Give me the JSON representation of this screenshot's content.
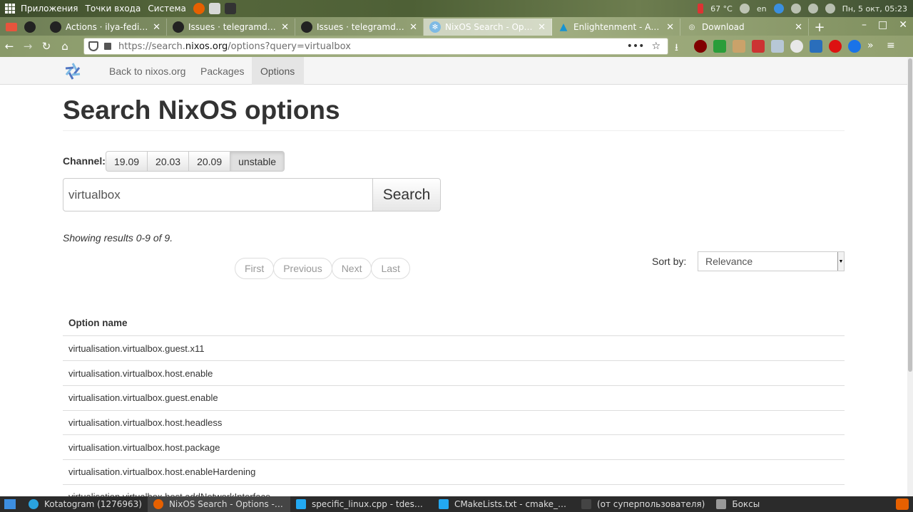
{
  "desktop": {
    "menus": [
      "Приложения",
      "Точки входа",
      "Система"
    ],
    "temperature": "67 °C",
    "keyboard_layout": "en",
    "datetime": "Пн, 5 окт, 05:23"
  },
  "browser": {
    "tabs": [
      {
        "title": "Actions · ilya-fedin/td",
        "icon": "github-icon"
      },
      {
        "title": "Issues · telegramdesk",
        "icon": "github-icon"
      },
      {
        "title": "Issues · telegramdesk",
        "icon": "github-icon"
      },
      {
        "title": "NixOS Search - Option",
        "icon": "nixos-icon",
        "active": true
      },
      {
        "title": "Enlightenment - Arch",
        "icon": "arch-icon"
      },
      {
        "title": "Download",
        "icon": "download-icon"
      }
    ],
    "url_prefix": "https://search.",
    "url_domain": "nixos.org",
    "url_suffix": "/options?query=virtualbox"
  },
  "site": {
    "nav": [
      "Back to nixos.org",
      "Packages",
      "Options"
    ],
    "active_nav": "Options",
    "page_title": "Search NixOS options",
    "channel_label": "Channel:",
    "channels": [
      "19.09",
      "20.03",
      "20.09",
      "unstable"
    ],
    "active_channel": "unstable",
    "search_value": "virtualbox",
    "search_button": "Search",
    "results_count": "Showing results 0-9 of 9.",
    "pager": [
      "First",
      "Previous",
      "Next",
      "Last"
    ],
    "sort_label": "Sort by:",
    "sort_value": "Relevance",
    "table_header": "Option name",
    "options": [
      "virtualisation.virtualbox.guest.x11",
      "virtualisation.virtualbox.host.enable",
      "virtualisation.virtualbox.guest.enable",
      "virtualisation.virtualbox.host.headless",
      "virtualisation.virtualbox.host.package",
      "virtualisation.virtualbox.host.enableHardening",
      "virtualisation.virtualbox.host.addNetworkInterface"
    ]
  },
  "taskbar": {
    "tasks": [
      {
        "title": "Kotatogram (1276963)",
        "icon": "telegram-icon"
      },
      {
        "title": "NixOS Search - Options - M...",
        "icon": "firefox-icon",
        "active": true
      },
      {
        "title": "specific_linux.cpp - tdeskt...",
        "icon": "vscode-icon"
      },
      {
        "title": "CMakeLists.txt - cmake_hel...",
        "icon": "vscode-icon"
      },
      {
        "title": "(от суперпользователя)",
        "icon": "terminal-icon"
      },
      {
        "title": "Боксы",
        "icon": "boxes-icon"
      }
    ]
  }
}
